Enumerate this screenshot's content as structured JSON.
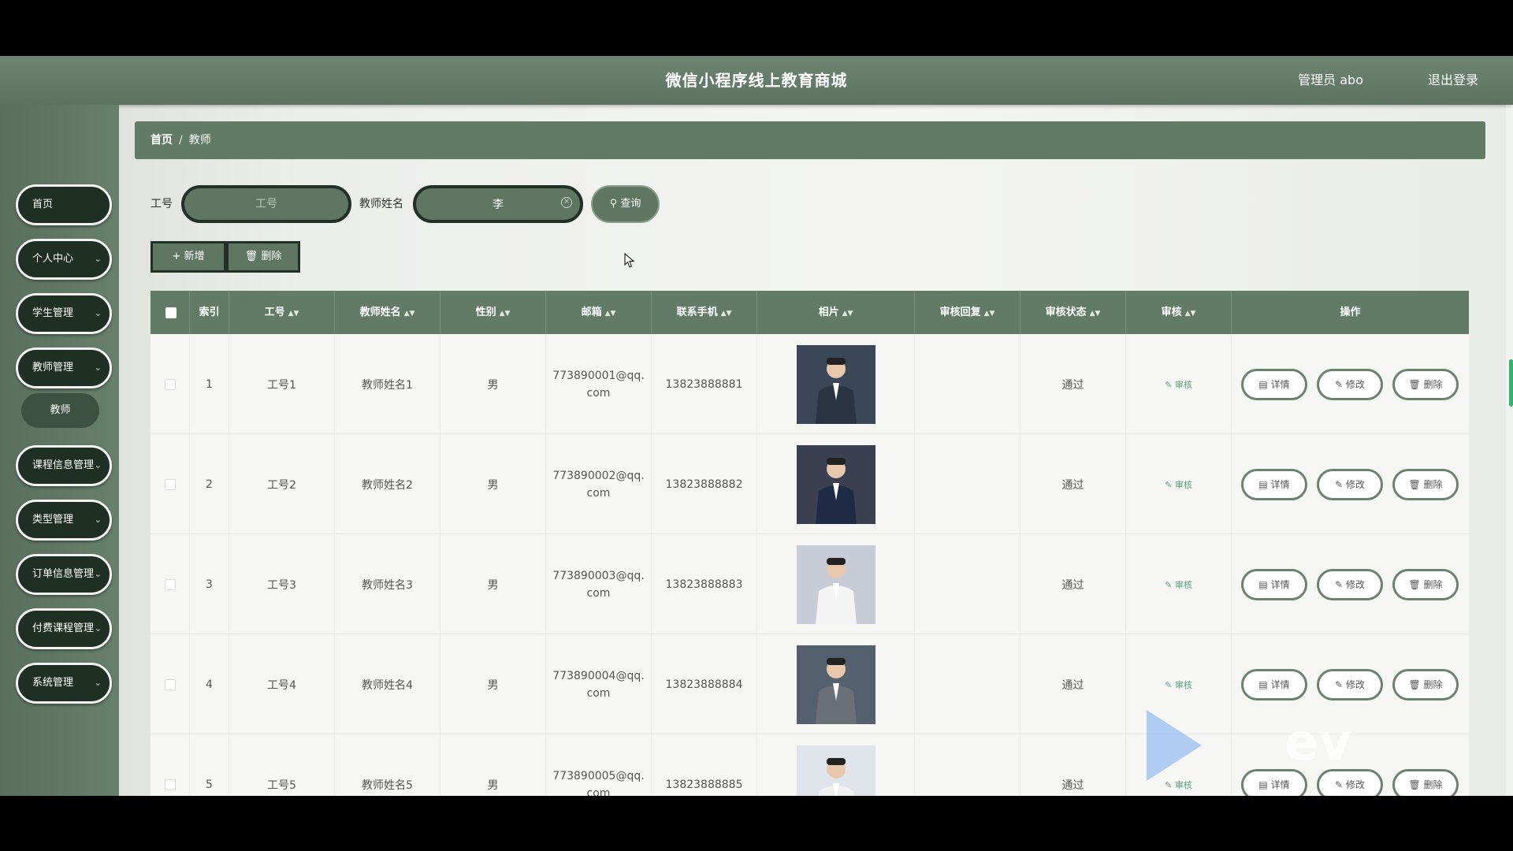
{
  "header": {
    "title": "微信小程序线上教育商城",
    "user": "管理员 abo",
    "logout": "退出登录"
  },
  "sidebar": {
    "items": [
      {
        "label": "首页",
        "expandable": false
      },
      {
        "label": "个人中心",
        "expandable": true
      },
      {
        "label": "学生管理",
        "expandable": true
      },
      {
        "label": "教师管理",
        "expandable": true
      },
      {
        "label": "课程信息管理",
        "expandable": true
      },
      {
        "label": "类型管理",
        "expandable": true
      },
      {
        "label": "订单信息管理",
        "expandable": true
      },
      {
        "label": "付费课程管理",
        "expandable": true
      },
      {
        "label": "系统管理",
        "expandable": true
      }
    ],
    "sub_item": "教师"
  },
  "breadcrumb": {
    "home": "首页",
    "separator": "/",
    "current": "教师"
  },
  "search": {
    "id_label": "工号",
    "id_placeholder": "工号",
    "id_value": "",
    "name_label": "教师姓名",
    "name_value": "李",
    "query_button": "查询"
  },
  "actions": {
    "add": "+ 新增",
    "delete": "删除"
  },
  "table": {
    "columns": [
      "索引",
      "工号",
      "教师姓名",
      "性别",
      "邮箱",
      "联系手机",
      "相片",
      "审核回复",
      "审核状态",
      "审核",
      "操作"
    ],
    "rows": [
      {
        "index": "1",
        "id": "工号1",
        "name": "教师姓名1",
        "gender": "男",
        "email_1": "773890001@qq.",
        "email_2": "com",
        "phone": "13823888881",
        "reply": "",
        "status": "通过",
        "audit": "审核"
      },
      {
        "index": "2",
        "id": "工号2",
        "name": "教师姓名2",
        "gender": "男",
        "email_1": "773890002@qq.",
        "email_2": "com",
        "phone": "13823888882",
        "reply": "",
        "status": "通过",
        "audit": "审核"
      },
      {
        "index": "3",
        "id": "工号3",
        "name": "教师姓名3",
        "gender": "男",
        "email_1": "773890003@qq.",
        "email_2": "com",
        "phone": "13823888883",
        "reply": "",
        "status": "通过",
        "audit": "审核"
      },
      {
        "index": "4",
        "id": "工号4",
        "name": "教师姓名4",
        "gender": "男",
        "email_1": "773890004@qq.",
        "email_2": "com",
        "phone": "13823888884",
        "reply": "",
        "status": "通过",
        "audit": "审核"
      },
      {
        "index": "5",
        "id": "工号5",
        "name": "教师姓名5",
        "gender": "男",
        "email_1": "773890005@qq.",
        "email_2": "com",
        "phone": "13823888885",
        "reply": "",
        "status": "通过",
        "audit": "审核"
      }
    ],
    "op_detail": "详情",
    "op_edit": "修改",
    "op_delete": "删除"
  },
  "colors": {
    "primary": "#627b67",
    "dark": "#223128",
    "audit": "#5aa37e"
  }
}
